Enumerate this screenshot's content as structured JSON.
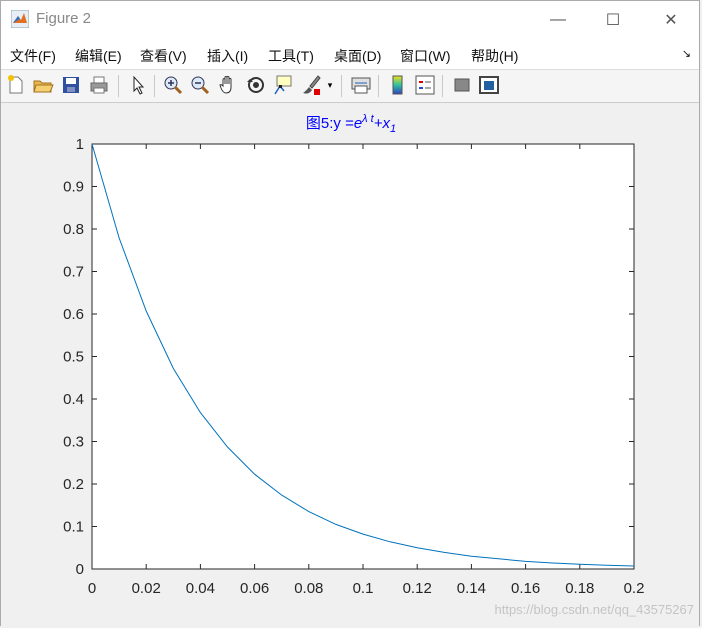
{
  "window": {
    "title": "Figure 2",
    "controls": {
      "minimize": "—",
      "maximize": "☐",
      "close": "✕"
    }
  },
  "menu": {
    "items": [
      {
        "label": "文件(F)"
      },
      {
        "label": "编辑(E)"
      },
      {
        "label": "查看(V)"
      },
      {
        "label": "插入(I)"
      },
      {
        "label": "工具(T)"
      },
      {
        "label": "桌面(D)"
      },
      {
        "label": "窗口(W)"
      },
      {
        "label": "帮助(H)"
      }
    ],
    "overflow_arrow": "↘"
  },
  "toolbar": {
    "icons": [
      "new-figure-icon",
      "open-file-icon",
      "save-icon",
      "print-icon",
      "pointer-icon",
      "zoom-in-icon",
      "zoom-out-icon",
      "pan-icon",
      "rotate-3d-icon",
      "data-cursor-icon",
      "brush-icon",
      "brush-dropdown-icon",
      "link-plot-icon",
      "colorbar-icon",
      "legend-icon",
      "hide-plot-tools-icon",
      "show-plot-tools-icon"
    ]
  },
  "chart_data": {
    "type": "line",
    "title_parts": {
      "prefix": "图5:y =",
      "base": "e",
      "exponent": "λ t",
      "plus": "+x",
      "subscript": "1"
    },
    "xlim": [
      0,
      0.2
    ],
    "ylim": [
      0,
      1
    ],
    "xticks": [
      "0",
      "0.02",
      "0.04",
      "0.06",
      "0.08",
      "0.1",
      "0.12",
      "0.14",
      "0.16",
      "0.18",
      "0.2"
    ],
    "yticks": [
      "0",
      "0.1",
      "0.2",
      "0.3",
      "0.4",
      "0.5",
      "0.6",
      "0.7",
      "0.8",
      "0.9",
      "1"
    ],
    "series": [
      {
        "color": "#0072bd",
        "x": [
          0,
          0.01,
          0.02,
          0.03,
          0.04,
          0.05,
          0.06,
          0.07,
          0.08,
          0.09,
          0.1,
          0.11,
          0.12,
          0.13,
          0.14,
          0.15,
          0.16,
          0.17,
          0.18,
          0.19,
          0.2
        ],
        "y": [
          1,
          0.779,
          0.607,
          0.472,
          0.368,
          0.287,
          0.223,
          0.174,
          0.135,
          0.105,
          0.082,
          0.064,
          0.05,
          0.039,
          0.03,
          0.024,
          0.018,
          0.014,
          0.011,
          0.009,
          0.007
        ]
      }
    ]
  },
  "watermark": "https://blog.csdn.net/qq_43575267"
}
